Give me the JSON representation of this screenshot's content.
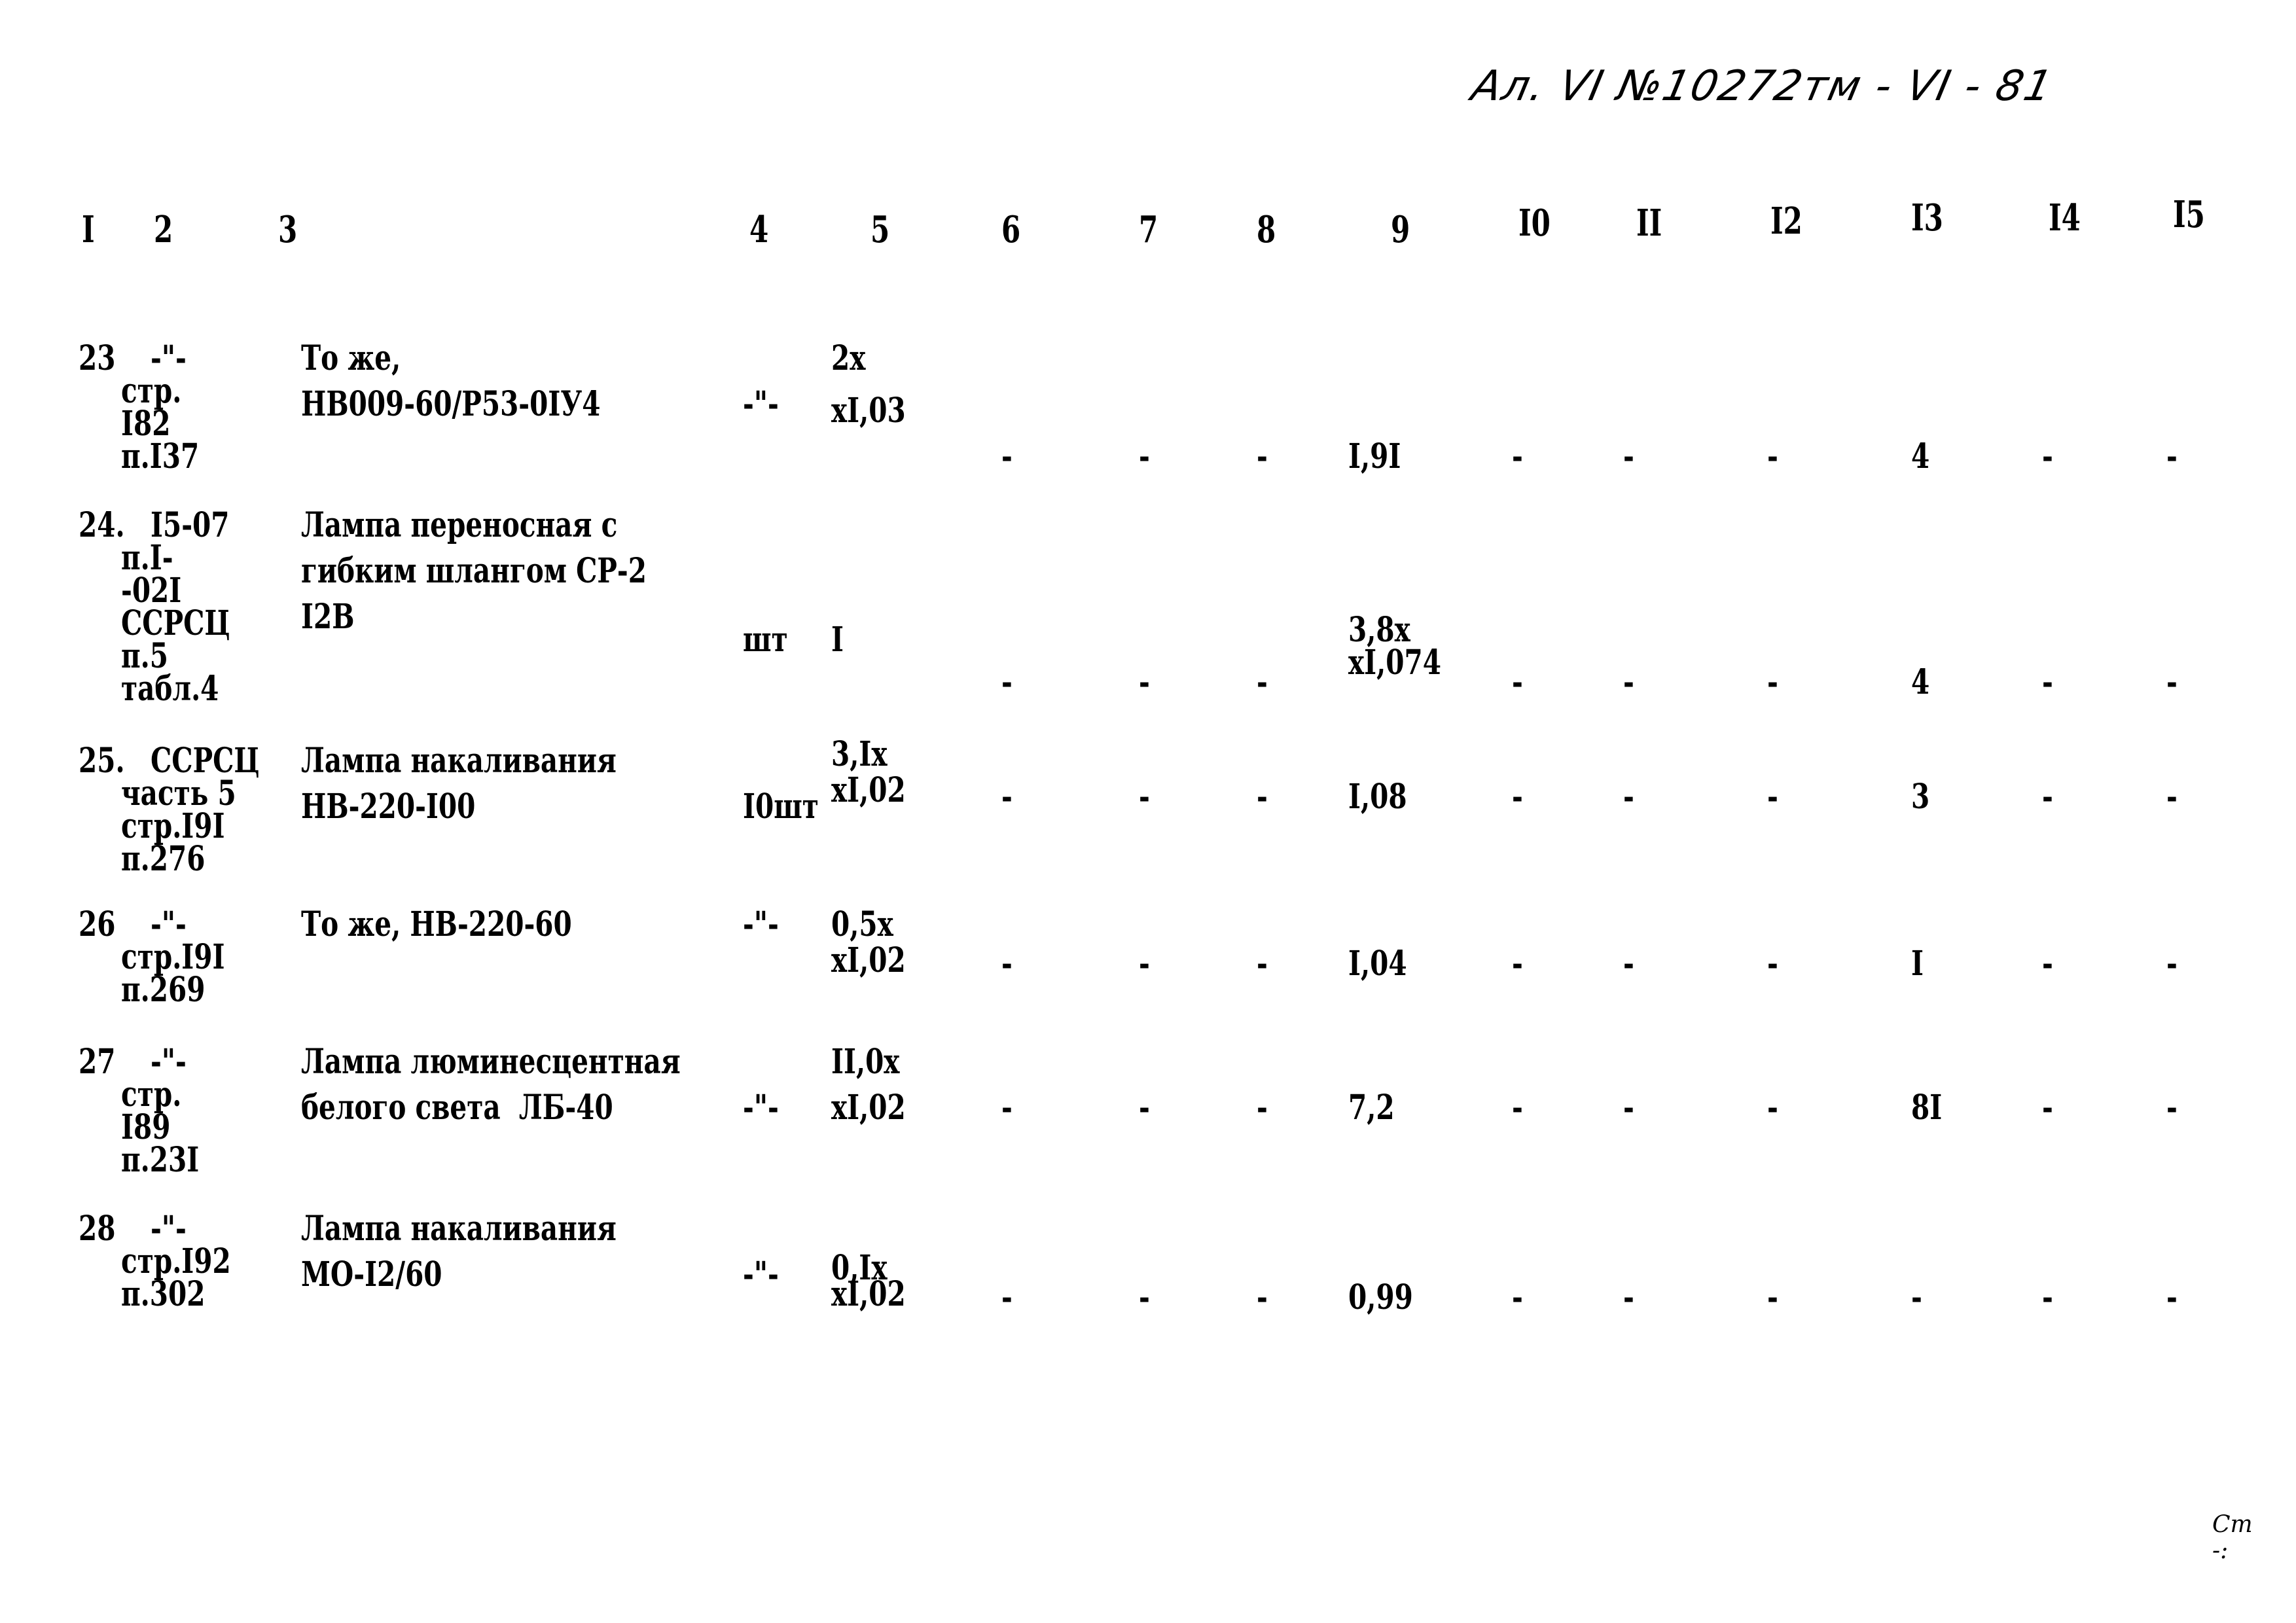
{
  "stamp": "Ал. VI №10272тм - VI - 81",
  "columns": [
    "I",
    "2",
    "3",
    "4",
    "5",
    "6",
    "7",
    "8",
    "9",
    "I0",
    "II",
    "I2",
    "I3",
    "I4",
    "I5"
  ],
  "rows": [
    {
      "no": "23",
      "ref": [
        "-\"-",
        "стр.",
        "I82",
        "п.I37"
      ],
      "name": [
        "То же,",
        "НВ009-60/Р53-0IУ4"
      ],
      "unit": "-\"-",
      "qty": [
        "2х",
        "хI,03"
      ],
      "c6": "-",
      "c7": "-",
      "c8": "-",
      "c9": [
        "I,9I"
      ],
      "c10": "-",
      "c11": "-",
      "c12": "-",
      "c13": "4",
      "c14": "-",
      "c15": "-"
    },
    {
      "no": "24.",
      "ref": [
        "I5-07",
        "п.I-",
        "-02I",
        "ССРСЦ",
        "п.5",
        "табл.4"
      ],
      "name": [
        "Лампа переносная с",
        "гибким шлангом СР-2",
        "I2В"
      ],
      "unit": "шт",
      "qty": [
        "I"
      ],
      "c6": "-",
      "c7": "-",
      "c8": "-",
      "c9": [
        "3,8х",
        "хI,074"
      ],
      "c10": "-",
      "c11": "-",
      "c12": "-",
      "c13": "4",
      "c14": "-",
      "c15": "-"
    },
    {
      "no": "25.",
      "ref": [
        "ССРСЦ",
        "часть 5",
        "стр.I9I",
        "п.276"
      ],
      "name": [
        "Лампа накаливания",
        "НВ-220-I00"
      ],
      "unit": "I0шт",
      "qty": [
        "3,Iх",
        "хI,02"
      ],
      "c6": "-",
      "c7": "-",
      "c8": "-",
      "c9": [
        "I,08"
      ],
      "c10": "-",
      "c11": "-",
      "c12": "-",
      "c13": "3",
      "c14": "-",
      "c15": "-"
    },
    {
      "no": "26",
      "ref": [
        "-\"-",
        "стр.I9I",
        "п.269"
      ],
      "name": [
        "То же, НВ-220-60"
      ],
      "unit": "-\"-",
      "qty": [
        "0,5х",
        "хI,02"
      ],
      "c6": "-",
      "c7": "-",
      "c8": "-",
      "c9": [
        "I,04"
      ],
      "c10": "-",
      "c11": "-",
      "c12": "-",
      "c13": "I",
      "c14": "-",
      "c15": "-"
    },
    {
      "no": "27",
      "ref": [
        "-\"-",
        "стр.",
        "I89",
        "п.23I"
      ],
      "name": [
        "Лампа люминесцентная",
        "белого света  ЛБ-40"
      ],
      "unit": "-\"-",
      "qty": [
        "II,0х",
        "хI,02"
      ],
      "c6": "-",
      "c7": "-",
      "c8": "-",
      "c9": [
        "7,2"
      ],
      "c10": "-",
      "c11": "-",
      "c12": "-",
      "c13": "8I",
      "c14": "-",
      "c15": "-"
    },
    {
      "no": "28",
      "ref": [
        "-\"-",
        "стр.I92",
        "п.302"
      ],
      "name": [
        "Лампа накаливания",
        "МО-I2/60"
      ],
      "unit": "-\"-",
      "qty": [
        "0,Iх",
        "хI,02"
      ],
      "c6": "-",
      "c7": "-",
      "c8": "-",
      "c9": [
        "0,99"
      ],
      "c10": "-",
      "c11": "-",
      "c12": "-",
      "c13": "-",
      "c14": "-",
      "c15": "-"
    }
  ],
  "corner_mark": [
    "Ст",
    "-:"
  ]
}
